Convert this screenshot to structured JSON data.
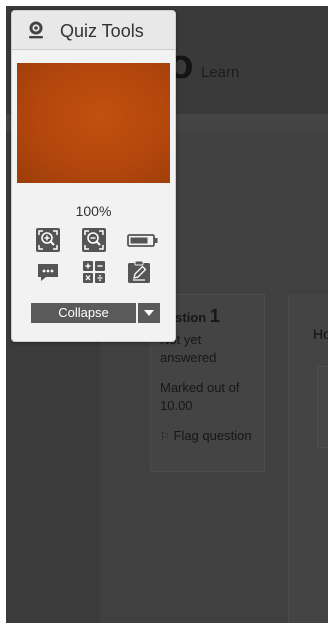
{
  "background": {
    "logo_text": "Learn",
    "logo_mark": "O",
    "question_nav": {
      "title_prefix": "uestion",
      "number": "1",
      "state": "Not yet answered",
      "marks": "Marked out of 10.00",
      "flag": "Flag question"
    },
    "content_heading": "Ho"
  },
  "quiz_tools": {
    "title": "Quiz Tools",
    "zoom_level": "100%",
    "icons": [
      "zoom-in-icon",
      "zoom-out-icon",
      "battery-icon",
      "chat-icon",
      "calculator-icon",
      "notepad-icon"
    ],
    "collapse_label": "Collapse",
    "video_color": "#b5490d"
  }
}
